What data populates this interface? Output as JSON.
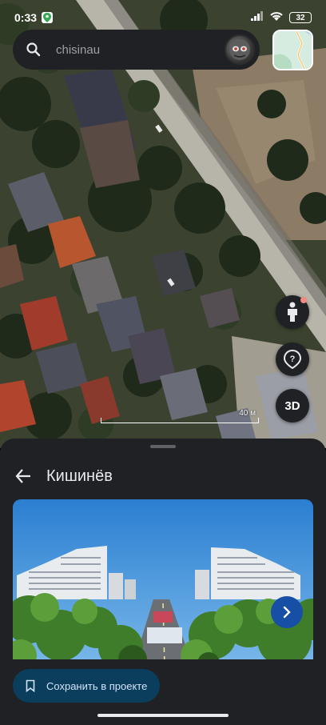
{
  "status_bar": {
    "time": "0:33",
    "battery": "32",
    "icons": [
      "maps-app-icon",
      "signal-icon",
      "wifi-icon",
      "battery-icon"
    ]
  },
  "search": {
    "value": "chisinau",
    "placeholder": "chisinau"
  },
  "map": {
    "scale_label": "40 м",
    "buttons": [
      "street-view-icon",
      "location-icon",
      "3D"
    ],
    "three_d_label": "3D"
  },
  "place": {
    "title": "Кишинёв",
    "save_label": "Сохранить в проекте"
  },
  "colors": {
    "sheet_bg": "#202124",
    "save_button_bg": "#0b3d5c",
    "next_button_bg": "#174ea6",
    "notification_dot": "#f28b82"
  }
}
